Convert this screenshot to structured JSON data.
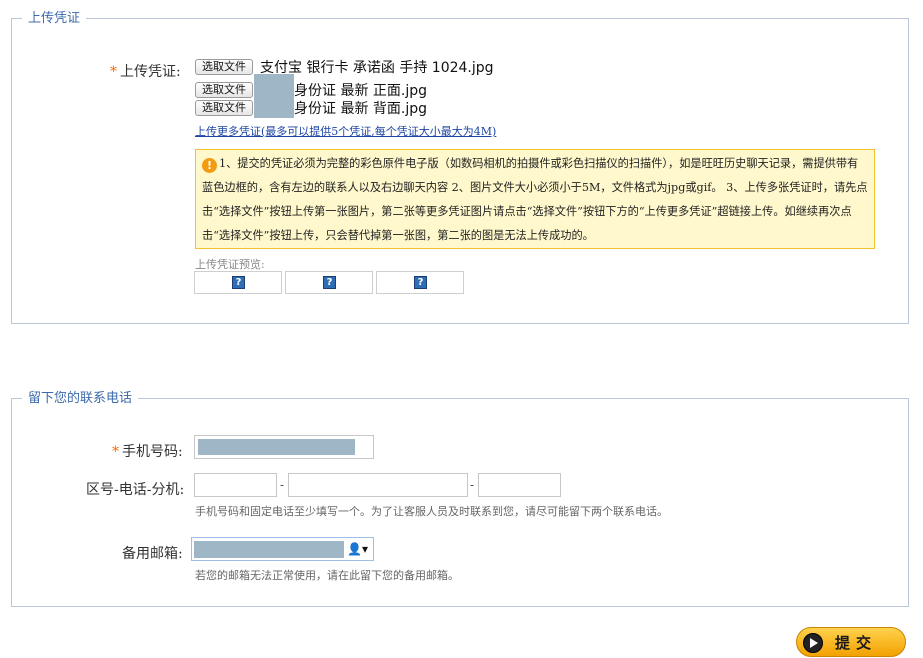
{
  "upload_section": {
    "legend": "上传凭证",
    "label_star": "*",
    "label": "上传凭证:",
    "file_button_label": "选取文件",
    "files": [
      "支付宝 银行卡 承诺函 手持 1024.jpg",
      "身份证 最新 正面.jpg",
      "身份证 最新 背面.jpg"
    ],
    "more_link": "上传更多凭证(最多可以提供5个凭证,每个凭证大小最大为4M)",
    "notice_icon": "warning-icon",
    "notice_text": "1、提交的凭证必须为完整的彩色原件电子版（如数码相机的拍摄件或彩色扫描仪的扫描件），如是旺旺历史聊天记录，需提供带有蓝色边框的，含有左边的联系人以及右边聊天内容 2、图片文件大小必须小于5M，文件格式为jpg或gif。 3、上传多张凭证时，请先点击“选择文件”按钮上传第一张图片，第二张等更多凭证图片请点击“选择文件”按钮下方的“上传更多凭证”超链接上传。如继续再次点击“选择文件”按钮上传，只会替代掉第一张图，第二张的图是无法上传成功的。",
    "preview_label": "上传凭证预览:",
    "preview_placeholder": "?"
  },
  "contact_section": {
    "legend": "留下您的联系电话",
    "mobile_label_star": "*",
    "mobile_label": "手机号码:",
    "phone_label": "区号-电话-分机:",
    "phone_separator": "-",
    "phone_hint": "手机号码和固定电话至少填写一个。为了让客服人员及时联系到您，请尽可能留下两个联系电话。",
    "email_label": "备用邮箱:",
    "email_hint": "若您的邮箱无法正常使用，请在此留下您的备用邮箱。",
    "contact_icon": "👤▾"
  },
  "submit": {
    "label": "提交"
  },
  "colors": {
    "legend": "#3d6aaa",
    "border": "#b9c6dc",
    "required_star": "#ff6600",
    "notice_bg": "#fff8cc",
    "notice_border": "#f0c230",
    "redaction": "#9fb6c7"
  }
}
